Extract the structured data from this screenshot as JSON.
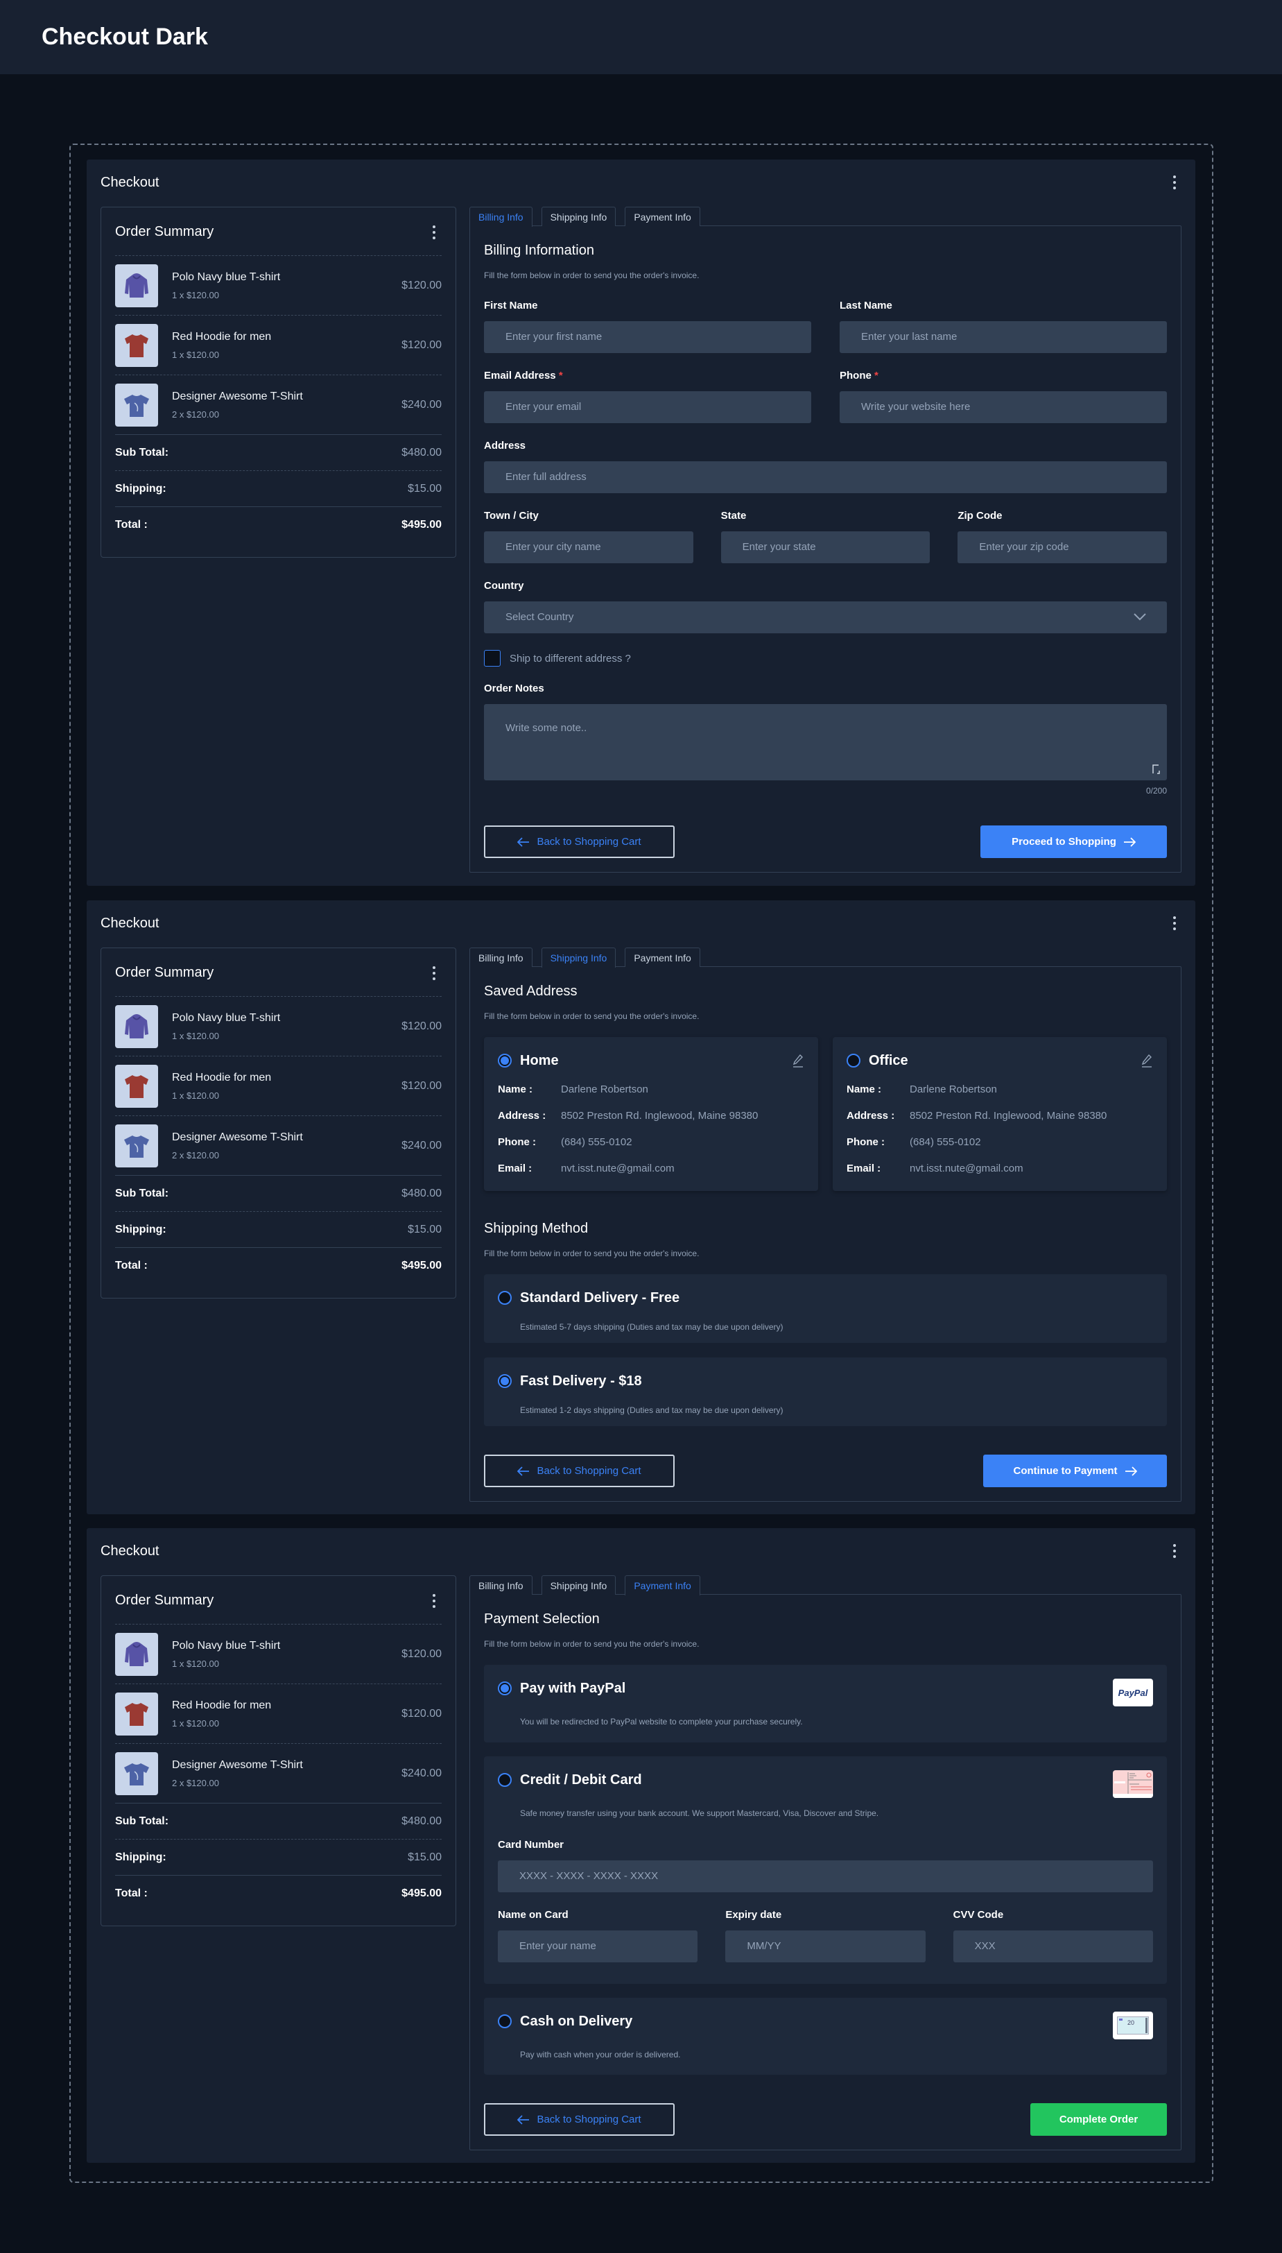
{
  "page_title": "Checkout Dark",
  "section_title": "Checkout",
  "order_summary": {
    "title": "Order Summary",
    "items": [
      {
        "name": "Polo Navy blue T-shirt",
        "qty": "1 x $120.00",
        "price": "$120.00",
        "image": "purple-hoodie"
      },
      {
        "name": "Red Hoodie for men",
        "qty": "1 x $120.00",
        "price": "$120.00",
        "image": "red-tshirt"
      },
      {
        "name": "Designer Awesome T-Shirt",
        "qty": "2 x $120.00",
        "price": "$240.00",
        "image": "blue-tshirt"
      }
    ],
    "subtotal_label": "Sub Total:",
    "subtotal": "$480.00",
    "shipping_label": "Shipping:",
    "shipping": "$15.00",
    "total_label": "Total :",
    "total": "$495.00"
  },
  "tabs": [
    "Billing Info",
    "Shipping Info",
    "Payment Info"
  ],
  "subtitle": "Fill the form below in order to send you the order's invoice.",
  "back_label": "Back to Shopping Cart",
  "billing": {
    "heading": "Billing Information",
    "first_name": {
      "label": "First Name",
      "placeholder": "Enter your first name"
    },
    "last_name": {
      "label": "Last Name",
      "placeholder": "Enter your last name"
    },
    "email": {
      "label": "Email Address",
      "placeholder": "Enter your email"
    },
    "phone": {
      "label": "Phone",
      "placeholder": "Write your website here"
    },
    "required_mark": "*",
    "address": {
      "label": "Address",
      "placeholder": "Enter full address"
    },
    "city": {
      "label": "Town / City",
      "placeholder": "Enter your city name"
    },
    "state": {
      "label": "State",
      "placeholder": "Enter your state"
    },
    "zip": {
      "label": "Zip Code",
      "placeholder": "Enter your zip code"
    },
    "country": {
      "label": "Country",
      "placeholder": "Select Country"
    },
    "ship_different": "Ship to different address ?",
    "notes": {
      "label": "Order Notes",
      "placeholder": "Write some note..",
      "counter": "0/200"
    },
    "proceed_label": "Proceed to Shopping"
  },
  "shipping": {
    "saved_heading": "Saved Address",
    "addresses": [
      {
        "title": "Home",
        "selected": true,
        "name": "Darlene Robertson",
        "address": "8502 Preston Rd. Inglewood, Maine 98380",
        "phone": "(684) 555-0102",
        "email": "nvt.isst.nute@gmail.com"
      },
      {
        "title": "Office",
        "selected": false,
        "name": "Darlene Robertson",
        "address": "8502 Preston Rd. Inglewood, Maine 98380",
        "phone": "(684) 555-0102",
        "email": "nvt.isst.nute@gmail.com"
      }
    ],
    "field_labels": {
      "name": "Name :",
      "address": "Address :",
      "phone": "Phone :",
      "email": "Email :"
    },
    "method_heading": "Shipping Method",
    "methods": [
      {
        "title": "Standard Delivery - Free",
        "desc": "Estimated 5-7 days shipping (Duties and tax may be due upon delivery)",
        "selected": false
      },
      {
        "title": "Fast Delivery - $18",
        "desc": "Estimated 1-2 days shipping (Duties and tax may be due upon delivery)",
        "selected": true
      }
    ],
    "continue_label": "Continue to Payment"
  },
  "payment": {
    "heading": "Payment Selection",
    "paypal": {
      "title": "Pay with PayPal",
      "desc": "You will be redirected to PayPal website to complete your purchase securely.",
      "logo_text": "PayPal",
      "selected": true
    },
    "card": {
      "title": "Credit / Debit Card",
      "desc": "Safe money transfer using your bank account. We support Mastercard, Visa, Discover and Stripe.",
      "selected": false,
      "number": {
        "label": "Card Number",
        "placeholder": "XXXX - XXXX - XXXX - XXXX"
      },
      "name": {
        "label": "Name on Card",
        "placeholder": "Enter your name"
      },
      "expiry": {
        "label": "Expiry date",
        "placeholder": "MM/YY"
      },
      "cvv": {
        "label": "CVV Code",
        "placeholder": "XXX"
      }
    },
    "cash": {
      "title": "Cash on Delivery",
      "desc": "Pay with cash when your order is delivered.",
      "logo_text": "20",
      "selected": false
    },
    "complete_label": "Complete Order"
  },
  "colors": {
    "accent": "#3b82f6",
    "success": "#22c55e",
    "required": "#ef4444"
  }
}
